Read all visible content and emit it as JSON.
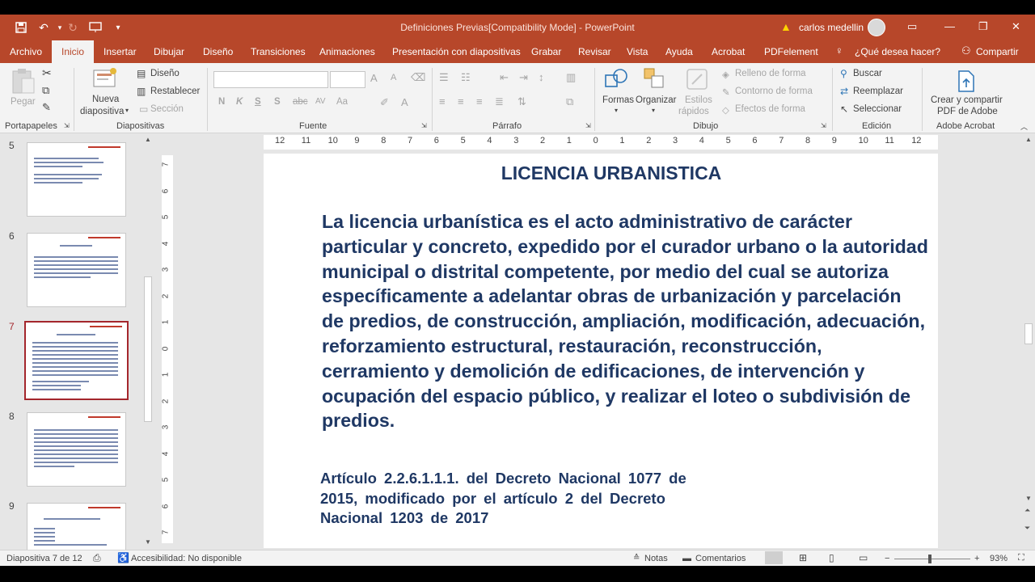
{
  "titlebar": {
    "title": "Definiciones Previas[Compatibility Mode]  -  PowerPoint",
    "user": "carlos medellin"
  },
  "menu": {
    "tabs": [
      "Archivo",
      "Inicio",
      "Insertar",
      "Dibujar",
      "Diseño",
      "Transiciones",
      "Animaciones",
      "Presentación con diapositivas",
      "Grabar",
      "Revisar",
      "Vista",
      "Ayuda",
      "Acrobat",
      "PDFelement"
    ],
    "tell_me": "¿Qué desea hacer?",
    "share": "Compartir"
  },
  "ribbon": {
    "portapapeles": {
      "paste": "Pegar",
      "label": "Portapapeles"
    },
    "diapositivas": {
      "new_slide_1": "Nueva",
      "new_slide_2": "diapositiva",
      "layout": "Diseño",
      "reset": "Restablecer",
      "section": "Sección",
      "label": "Diapositivas"
    },
    "fuente": {
      "bold": "N",
      "italic": "K",
      "underline": "S",
      "shadow": "S",
      "strike": "abc",
      "spacing": "AV",
      "case": "Aa",
      "color": "A",
      "label": "Fuente"
    },
    "parrafo": {
      "label": "Párrafo"
    },
    "dibujo": {
      "shapes": "Formas",
      "arrange": "Organizar",
      "styles_1": "Estilos",
      "styles_2": "rápidos",
      "fill": "Relleno de forma",
      "outline": "Contorno de forma",
      "effects": "Efectos de forma",
      "label": "Dibujo"
    },
    "edicion": {
      "find": "Buscar",
      "replace": "Reemplazar",
      "select": "Seleccionar",
      "label": "Edición"
    },
    "adobe": {
      "create_1": "Crear y compartir",
      "create_2": "PDF de Adobe",
      "label": "Adobe Acrobat"
    }
  },
  "thumbnails": [
    {
      "num": "5"
    },
    {
      "num": "6"
    },
    {
      "num": "7"
    },
    {
      "num": "8"
    },
    {
      "num": "9"
    }
  ],
  "ruler": {
    "h": [
      "12",
      "11",
      "10",
      "9",
      "8",
      "7",
      "6",
      "5",
      "4",
      "3",
      "2",
      "1",
      "0",
      "1",
      "2",
      "3",
      "4",
      "5",
      "6",
      "7",
      "8",
      "9",
      "10",
      "11",
      "12"
    ],
    "v": [
      "7",
      "6",
      "5",
      "4",
      "3",
      "2",
      "1",
      "0",
      "1",
      "2",
      "3",
      "4",
      "5",
      "6",
      "7"
    ]
  },
  "slide": {
    "title": "LICENCIA URBANISTICA",
    "body": "La licencia urbanística es el acto administrativo de carácter particular y concreto, expedido por el curador urbano o la autoridad municipal o distrital competente, por medio del cual se autoriza específicamente a adelantar obras de urbanización y parcelación de predios, de construcción, ampliación, modificación, adecuación, reforzamiento estructural, restauración, reconstrucción, cerramiento y demolición de edificaciones, de intervención y ocupación del espacio público, y realizar el loteo o subdivisión de predios.",
    "reference": "Artículo 2.2.6.1.1.1. del Decreto Nacional 1077 de 2015, modificado por el artículo 2 del Decreto Nacional 1203 de 2017"
  },
  "status": {
    "slide_counter": "Diapositiva 7 de 12",
    "accessibility": "Accesibilidad: No disponible",
    "notes": "Notas",
    "comments": "Comentarios",
    "zoom": "93%"
  },
  "colors": {
    "accent": "#b7472a",
    "slide_text": "#1f3864",
    "selected_thumb": "#a4262c"
  }
}
